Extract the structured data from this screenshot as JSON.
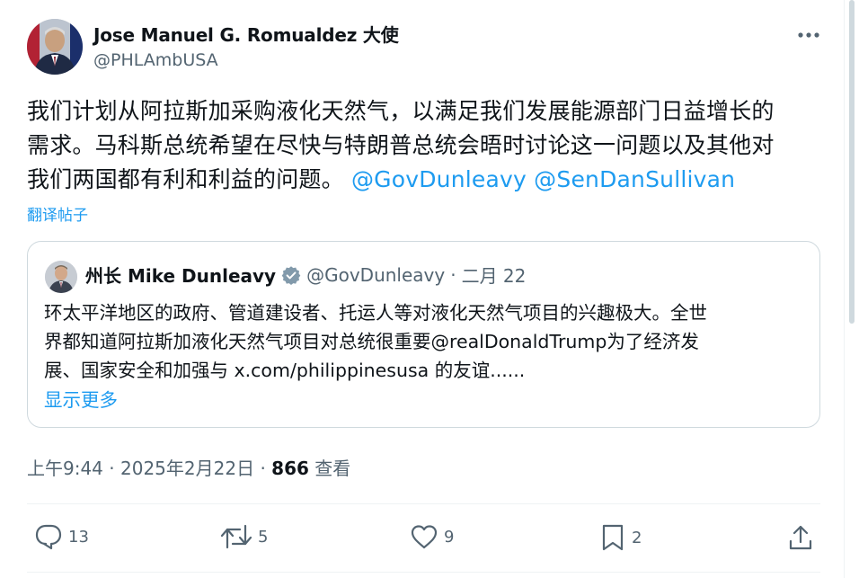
{
  "author": {
    "name": "Jose Manuel G. Romualdez 大使",
    "handle": "@PHLAmbUSA"
  },
  "tweet": {
    "text_lines": [
      "我们计划从阿拉斯加采购液化天然气，以满足我们发展能源部门日益增长的",
      "需求。马科斯总统希望在尽快与特朗普总统会晤时讨论这一问题以及其他对",
      "我们两国都有利和利益的问题。"
    ],
    "mentions": [
      "@GovDunleavy",
      "@SenDanSullivan"
    ],
    "translate_label": "翻译帖子"
  },
  "quote": {
    "name": "州长 Mike Dunleavy",
    "handle": "@GovDunleavy",
    "separator": "·",
    "date": "二月 22",
    "text_lines": [
      "环太平洋地区的政府、管道建设者、托运人等对液化天然气项目的兴趣极大。全世",
      "界都知道阿拉斯加液化天然气项目对总统很重要@realDonaldTrump为了经济发",
      "展、国家安全和加强与 x.com/philippinesusa 的友谊......"
    ],
    "show_more": "显示更多",
    "verified_color": "#829aab"
  },
  "meta": {
    "time": "上午9:44",
    "dot": "·",
    "date": "2025年2月22日",
    "views": "866",
    "views_label": "查看"
  },
  "actions": {
    "replies": "13",
    "reposts": "5",
    "likes": "9",
    "bookmarks": "2"
  },
  "icons": {
    "more": "more-horizontal-icon",
    "reply": "reply-icon",
    "repost": "repost-icon",
    "like": "heart-icon",
    "bookmark": "bookmark-icon",
    "share": "share-icon",
    "verified": "verified-badge-icon"
  },
  "colors": {
    "accent": "#1d9bf0",
    "secondary_text": "#536471",
    "primary_text": "#0f1419",
    "border": "#cfd9de"
  }
}
